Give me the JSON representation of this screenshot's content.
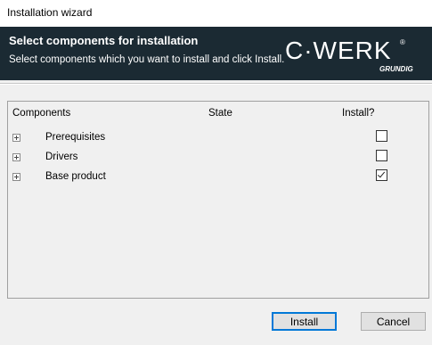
{
  "window": {
    "title": "Installation wizard"
  },
  "banner": {
    "heading": "Select components for installation",
    "subheading": "Select components which you want to install and click Install.",
    "logo": {
      "brand": "C·WERK",
      "maker": "GRUNDIG",
      "mark": "®"
    }
  },
  "table": {
    "columns": {
      "components": "Components",
      "state": "State",
      "install": "Install?"
    },
    "rows": [
      {
        "label": "Prerequisites",
        "state": "",
        "install": false
      },
      {
        "label": "Drivers",
        "state": "",
        "install": false
      },
      {
        "label": "Base product",
        "state": "",
        "install": true
      }
    ]
  },
  "buttons": {
    "install": "Install",
    "cancel": "Cancel"
  },
  "colors": {
    "banner_bg": "#1b2a33",
    "logo_blue": "#29a8df",
    "default_button_border": "#0078d7"
  }
}
